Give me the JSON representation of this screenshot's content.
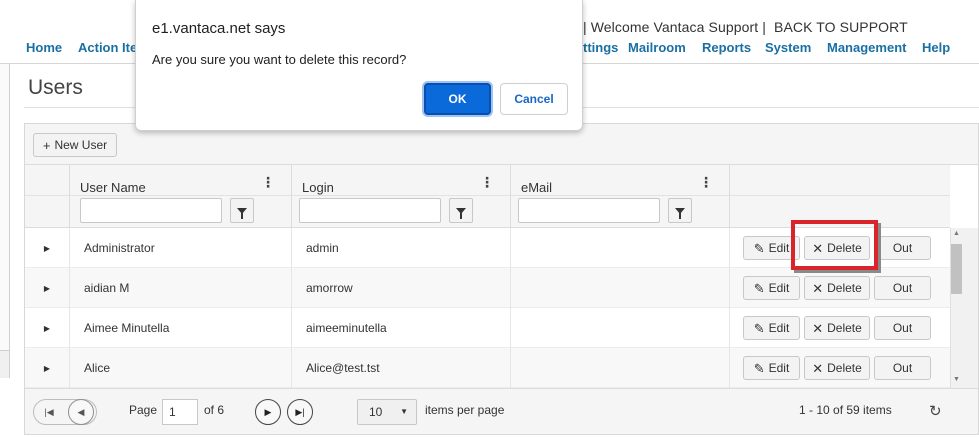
{
  "header": {
    "welcome": "| Welcome Vantaca Support |",
    "back_link": "BACK TO SUPPORT",
    "nav": [
      {
        "label": "Home"
      },
      {
        "label": "Action Ite"
      },
      {
        "label": "ttings"
      },
      {
        "label": "Mailroom"
      },
      {
        "label": "Reports"
      },
      {
        "label": "System"
      },
      {
        "label": "Management"
      },
      {
        "label": "Help"
      }
    ]
  },
  "page": {
    "title": "Users"
  },
  "toolbar": {
    "new_user_icon": "+",
    "new_user_label": "New User"
  },
  "columns": [
    {
      "label": "User Name"
    },
    {
      "label": "Login"
    },
    {
      "label": "eMail"
    }
  ],
  "rows": [
    {
      "user_name": "Administrator",
      "login": "admin",
      "email": ""
    },
    {
      "user_name": "aidian M",
      "login": "amorrow",
      "email": ""
    },
    {
      "user_name": "Aimee Minutella",
      "login": "aimeeminutella",
      "email": ""
    },
    {
      "user_name": "Alice",
      "login": "Alice@test.tst",
      "email": ""
    }
  ],
  "row_actions": {
    "edit_icon": "✎",
    "edit_label": "Edit",
    "delete_icon": "✕",
    "delete_label": "Delete",
    "out_label": "Out"
  },
  "pager": {
    "page_label": "Page",
    "current_page": "1",
    "of_label": "of 6",
    "page_size": "10",
    "items_per_page_label": "items per page",
    "summary": "1 - 10 of 59 items"
  },
  "dialog": {
    "title": "e1.vantaca.net says",
    "message": "Are you sure you want to delete this record?",
    "ok_label": "OK",
    "cancel_label": "Cancel"
  },
  "colors": {
    "nav": "#1a6fa3",
    "ok_button": "#0b6ad9",
    "highlight": "#d9242b"
  },
  "icons": {
    "filter": "funnel-icon",
    "expand": "caret-right-icon",
    "refresh": "refresh-icon"
  }
}
